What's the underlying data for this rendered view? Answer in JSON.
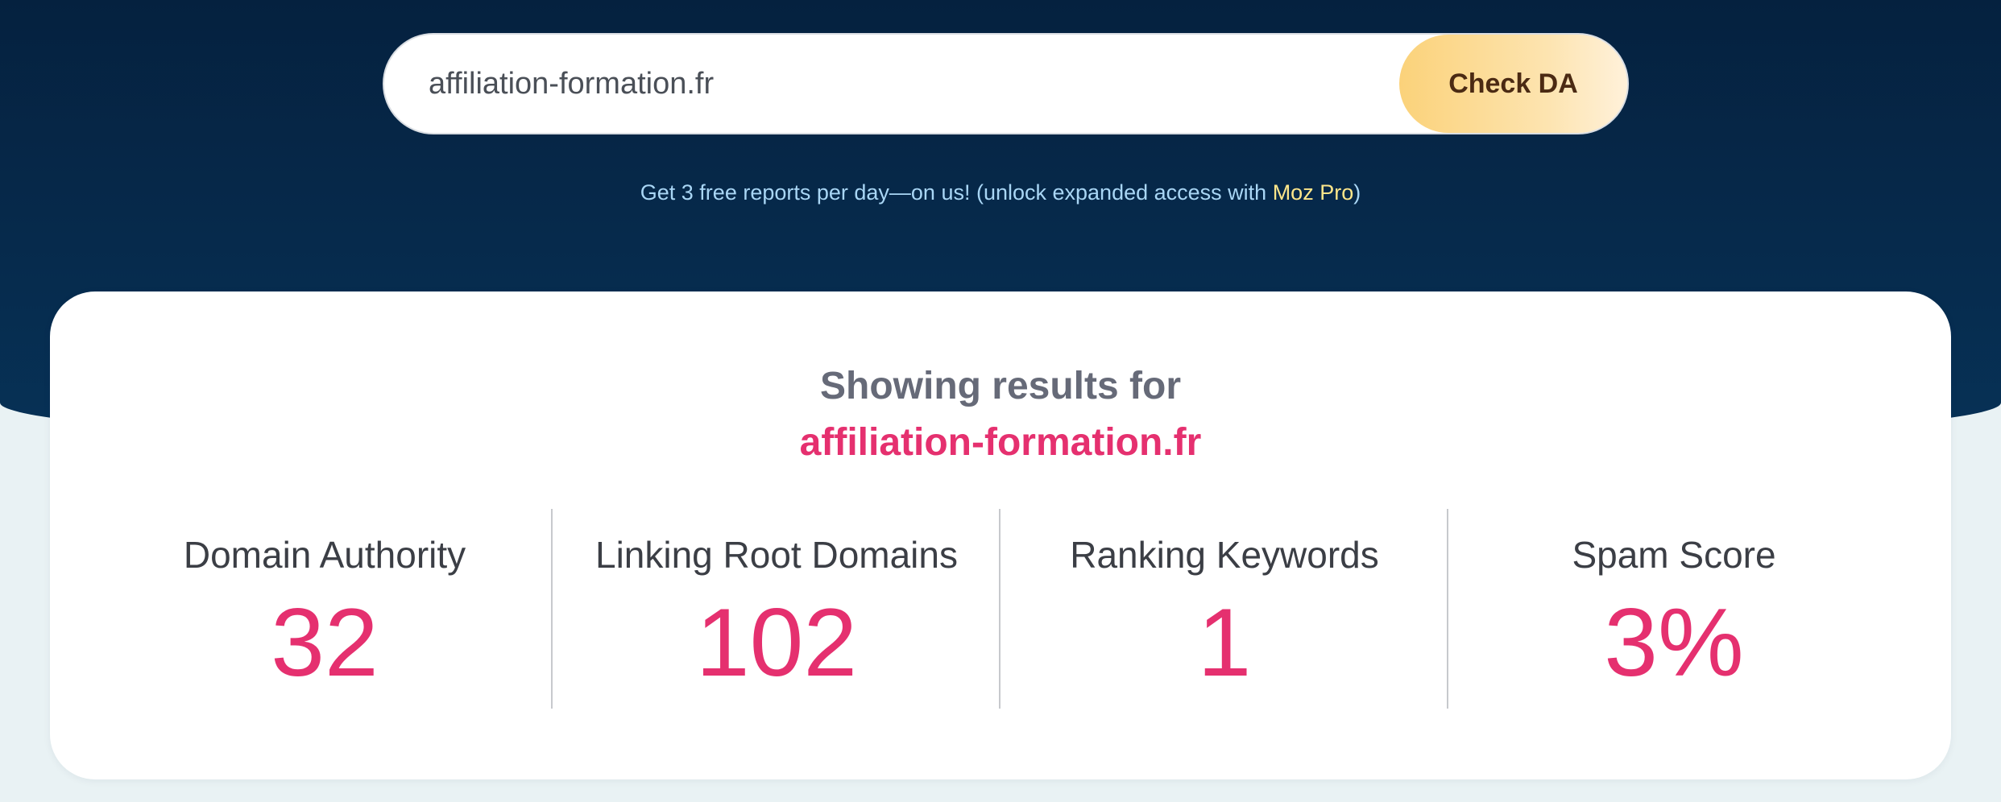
{
  "search": {
    "value": "affiliation-formation.fr",
    "button_label": "Check DA"
  },
  "promo": {
    "text": "Get 3 free reports per day—on us! (unlock expanded access with ",
    "link_text": "Moz Pro",
    "text_after": ")"
  },
  "results": {
    "heading": "Showing results for",
    "domain": "affiliation-formation.fr",
    "metrics": [
      {
        "label": "Domain Authority",
        "value": "32"
      },
      {
        "label": "Linking Root Domains",
        "value": "102"
      },
      {
        "label": "Ranking Keywords",
        "value": "1"
      },
      {
        "label": "Spam Score",
        "value": "3%"
      }
    ]
  },
  "colors": {
    "hero_bg": "#05213f",
    "accent_pink": "#e5306f",
    "button_gold": "#fbd27a",
    "link_yellow": "#fde68a"
  }
}
